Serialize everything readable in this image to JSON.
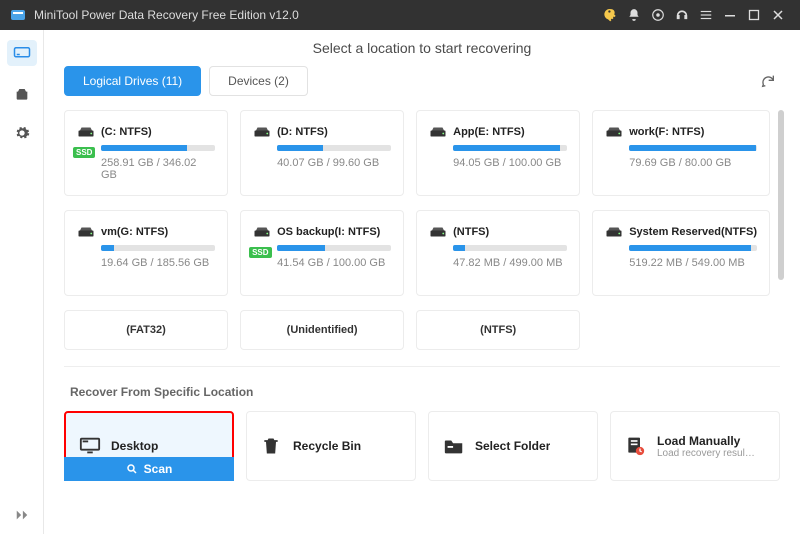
{
  "titlebar": {
    "title": "MiniTool Power Data Recovery Free Edition v12.0"
  },
  "page_title": "Select a location to start recovering",
  "tabs": {
    "logical": "Logical Drives (11)",
    "devices": "Devices (2)"
  },
  "drives": [
    {
      "label": "(C: NTFS)",
      "used": 258.91,
      "total": 346.02,
      "pct": 75,
      "ssd": true,
      "cap": "258.91 GB / 346.02 GB"
    },
    {
      "label": "(D: NTFS)",
      "used": 40.07,
      "total": 99.6,
      "pct": 40,
      "ssd": false,
      "cap": "40.07 GB / 99.60 GB"
    },
    {
      "label": "App(E: NTFS)",
      "used": 94.05,
      "total": 100.0,
      "pct": 94,
      "ssd": false,
      "cap": "94.05 GB / 100.00 GB"
    },
    {
      "label": "work(F: NTFS)",
      "used": 79.69,
      "total": 80.0,
      "pct": 99,
      "ssd": false,
      "cap": "79.69 GB / 80.00 GB"
    },
    {
      "label": "vm(G: NTFS)",
      "used": 19.64,
      "total": 185.56,
      "pct": 11,
      "ssd": false,
      "cap": "19.64 GB / 185.56 GB"
    },
    {
      "label": "OS backup(I: NTFS)",
      "used": 41.54,
      "total": 100.0,
      "pct": 42,
      "ssd": true,
      "cap": "41.54 GB / 100.00 GB"
    },
    {
      "label": "(NTFS)",
      "used": 47.82,
      "total": 499.0,
      "pct": 10,
      "ssd": false,
      "cap": "47.82 MB / 499.00 MB"
    },
    {
      "label": "System Reserved(NTFS)",
      "used": 519.22,
      "total": 549.0,
      "pct": 95,
      "ssd": false,
      "cap": "519.22 MB / 549.00 MB"
    }
  ],
  "drives_partial": [
    {
      "label": "(FAT32)"
    },
    {
      "label": "(Unidentified)"
    },
    {
      "label": "(NTFS)"
    }
  ],
  "recover_section": "Recover From Specific Location",
  "locations": {
    "desktop": {
      "title": "Desktop"
    },
    "recycle": {
      "title": "Recycle Bin"
    },
    "folder": {
      "title": "Select Folder"
    },
    "manual": {
      "title": "Load Manually",
      "sub": "Load recovery result (*..."
    }
  },
  "scan_label": "Scan",
  "ssd_badge": "SSD"
}
